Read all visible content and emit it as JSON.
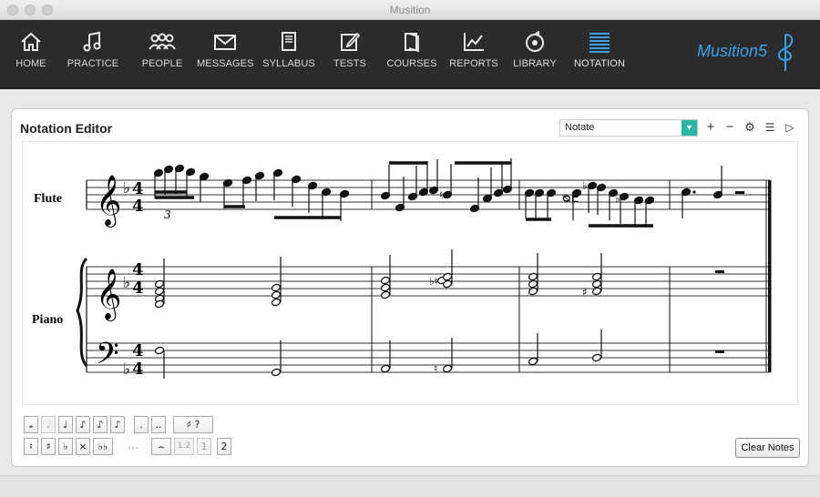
{
  "window": {
    "title": "Musition"
  },
  "nav": {
    "items": [
      {
        "label": "HOME",
        "icon": "home-icon"
      },
      {
        "label": "PRACTICE",
        "icon": "music-note-icon"
      },
      {
        "label": "PEOPLE",
        "icon": "people-icon"
      },
      {
        "label": "MESSAGES",
        "icon": "envelope-icon"
      },
      {
        "label": "SYLLABUS",
        "icon": "book-icon"
      },
      {
        "label": "TESTS",
        "icon": "pencil-icon"
      },
      {
        "label": "COURSES",
        "icon": "courses-icon"
      },
      {
        "label": "REPORTS",
        "icon": "chart-icon"
      },
      {
        "label": "LIBRARY",
        "icon": "disc-icon"
      },
      {
        "label": "NOTATION",
        "icon": "staff-lines-icon",
        "active": true
      }
    ],
    "brand": "Musition5"
  },
  "editor": {
    "title": "Notation Editor",
    "mode": "Notate",
    "toolbar": {
      "add": "+",
      "remove": "−",
      "settings": "⚙",
      "list": "☰",
      "play": "▷"
    }
  },
  "score": {
    "staves": [
      {
        "label": "Flute",
        "clef": "treble",
        "key": "♭",
        "time": [
          "4",
          "4"
        ],
        "tuplet": "3"
      },
      {
        "label": "Piano",
        "clef": "treble",
        "key": "♭",
        "time": [
          "4",
          "4"
        ]
      },
      {
        "label": "",
        "clef": "bass",
        "key": "♭",
        "time": [
          "4",
          "4"
        ]
      }
    ]
  },
  "palette": {
    "row1": [
      "𝅝",
      "𝅗𝅥",
      "♩",
      "♪",
      "♪",
      "♪",
      ".",
      "..",
      "♯ ?"
    ],
    "row2": [
      "♮",
      "♯",
      "♭",
      "×",
      "♭♭",
      "…",
      "⌢",
      "1:2",
      "1",
      "2"
    ]
  },
  "actions": {
    "clear_notes": "Clear Notes"
  },
  "colors": {
    "nav_bg": "#2b2b2b",
    "accent": "#2bb5a4",
    "brand": "#3aa0e8",
    "active_icon": "#3aa0e8"
  }
}
